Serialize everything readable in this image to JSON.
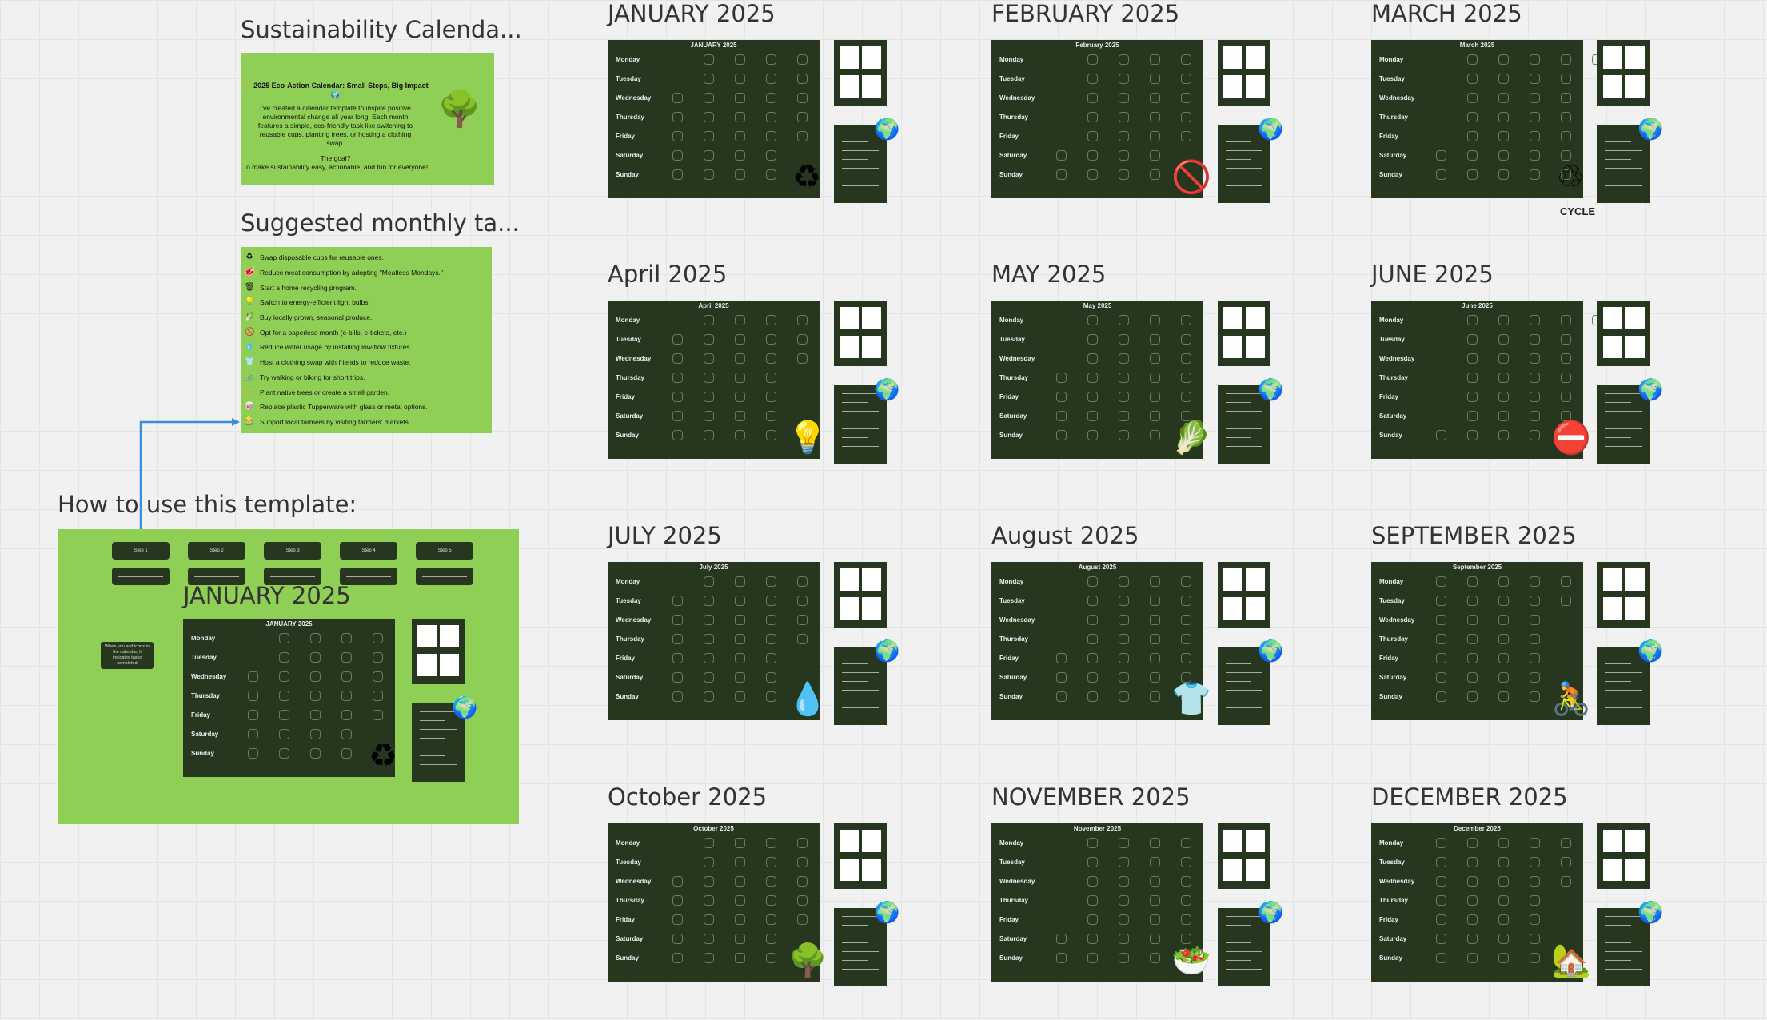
{
  "info_card": {
    "title": "Sustainability Calenda...",
    "heading": "2025 Eco-Action Calendar: Small Steps, Big Impact",
    "body": "I've created a calendar template to inspire positive environmental change all year long. Each month features a simple, eco-friendly task like switching to reusable cups, planting trees, or hosting a clothing swap.",
    "goal": "The goal?",
    "goal_text": "To make sustainability easy, actionable, and fun for everyone!",
    "leading_icon": "leaf-icon",
    "trailing_icon": "globe-icon",
    "side_icon": "tree-icon"
  },
  "tasks_card": {
    "title": "Suggested monthly ta...",
    "items": [
      {
        "icon": "recycle-icon",
        "label": "Swap disposable cups for reusable ones."
      },
      {
        "icon": "meat-icon",
        "label": "Reduce meat consumption by adopting \"Meatless Mondays.\""
      },
      {
        "icon": "recycle-bin-icon",
        "label": "Start a home recycling program."
      },
      {
        "icon": "lightbulb-icon",
        "label": "Switch to energy-efficient light bulbs."
      },
      {
        "icon": "produce-icon",
        "label": "Buy locally grown, seasonal produce."
      },
      {
        "icon": "no-paper-icon",
        "label": "Opt for a paperless month (e-bills, e-tickets, etc.)"
      },
      {
        "icon": "water-drop-icon",
        "label": "Reduce water usage by installing low-flow fixtures."
      },
      {
        "icon": "clothing-icon",
        "label": "Host a clothing swap with friends to reduce waste."
      },
      {
        "icon": "bike-icon",
        "label": "Try walking or biking for short trips."
      },
      {
        "icon": "plant-icon",
        "label": "Plant native trees or create a small garden."
      },
      {
        "icon": "container-icon",
        "label": "Replace plastic Tupperware with glass or metal options."
      },
      {
        "icon": "farmer-icon",
        "label": "Support local farmers by visiting farmers' markets."
      }
    ]
  },
  "howto_card": {
    "title": "How to use this template:",
    "steps": [
      "Step 1",
      "Step 2",
      "Step 3",
      "Step 4",
      "Step 5"
    ],
    "tooltip": "When you add icons to the calendar, it indicates tasks completed",
    "calendar_title": "JANUARY 2025",
    "calendar_header": "JANUARY 2025",
    "deco_icon": "recycle-icon"
  },
  "days": [
    "Monday",
    "Tuesday",
    "Wednesday",
    "Thursday",
    "Friday",
    "Saturday",
    "Sunday"
  ],
  "months": [
    {
      "title": "JANUARY 2025",
      "header": "JANUARY 2025",
      "first": 2,
      "days": 31,
      "deco": "recycle-icon",
      "deco_glyph": "♻"
    },
    {
      "title": "FEBRUARY 2025",
      "header": "February 2025",
      "first": 5,
      "days": 28,
      "deco": "no-meat-icon",
      "deco_glyph": "🚫"
    },
    {
      "title": "MARCH 2025",
      "header": "March 2025",
      "first": 5,
      "days": 31,
      "deco": "cycle-badge-icon",
      "deco_glyph": "♲",
      "deco_label": "CYCLE"
    },
    {
      "title": "April 2025",
      "header": "April 2025",
      "first": 1,
      "days": 30,
      "deco": "lightbulb-icon",
      "deco_glyph": "💡"
    },
    {
      "title": "MAY 2025",
      "header": "May 2025",
      "first": 3,
      "days": 31,
      "deco": "leafy-greens-icon",
      "deco_glyph": "🥬"
    },
    {
      "title": "JUNE 2025",
      "header": "June 2025",
      "first": 6,
      "days": 30,
      "deco": "no-paper-icon",
      "deco_glyph": "⛔"
    },
    {
      "title": "JULY 2025",
      "header": "July 2025",
      "first": 1,
      "days": 31,
      "deco": "water-hands-icon",
      "deco_glyph": "💧"
    },
    {
      "title": "August 2025",
      "header": "August 2025",
      "first": 4,
      "days": 31,
      "deco": "clothing-swap-icon",
      "deco_glyph": "👕"
    },
    {
      "title": "SEPTEMBER 2025",
      "header": "September 2025",
      "first": 0,
      "days": 30,
      "deco": "cyclist-icon",
      "deco_glyph": "🚴"
    },
    {
      "title": "October 2025",
      "header": "October 2025",
      "first": 2,
      "days": 31,
      "deco": "trees-icon",
      "deco_glyph": "🌳"
    },
    {
      "title": "NOVEMBER 2025",
      "header": "November 2025",
      "first": 5,
      "days": 30,
      "deco": "glass-container-icon",
      "deco_glyph": "🥗"
    },
    {
      "title": "DECEMBER 2025",
      "header": "December 2025",
      "first": 0,
      "days": 31,
      "deco": "farm-barn-icon",
      "deco_glyph": "🏡"
    }
  ],
  "colors": {
    "card_green": "#8fcf55",
    "calendar_dark": "#27361f",
    "connector_blue": "#3a8fd6"
  }
}
